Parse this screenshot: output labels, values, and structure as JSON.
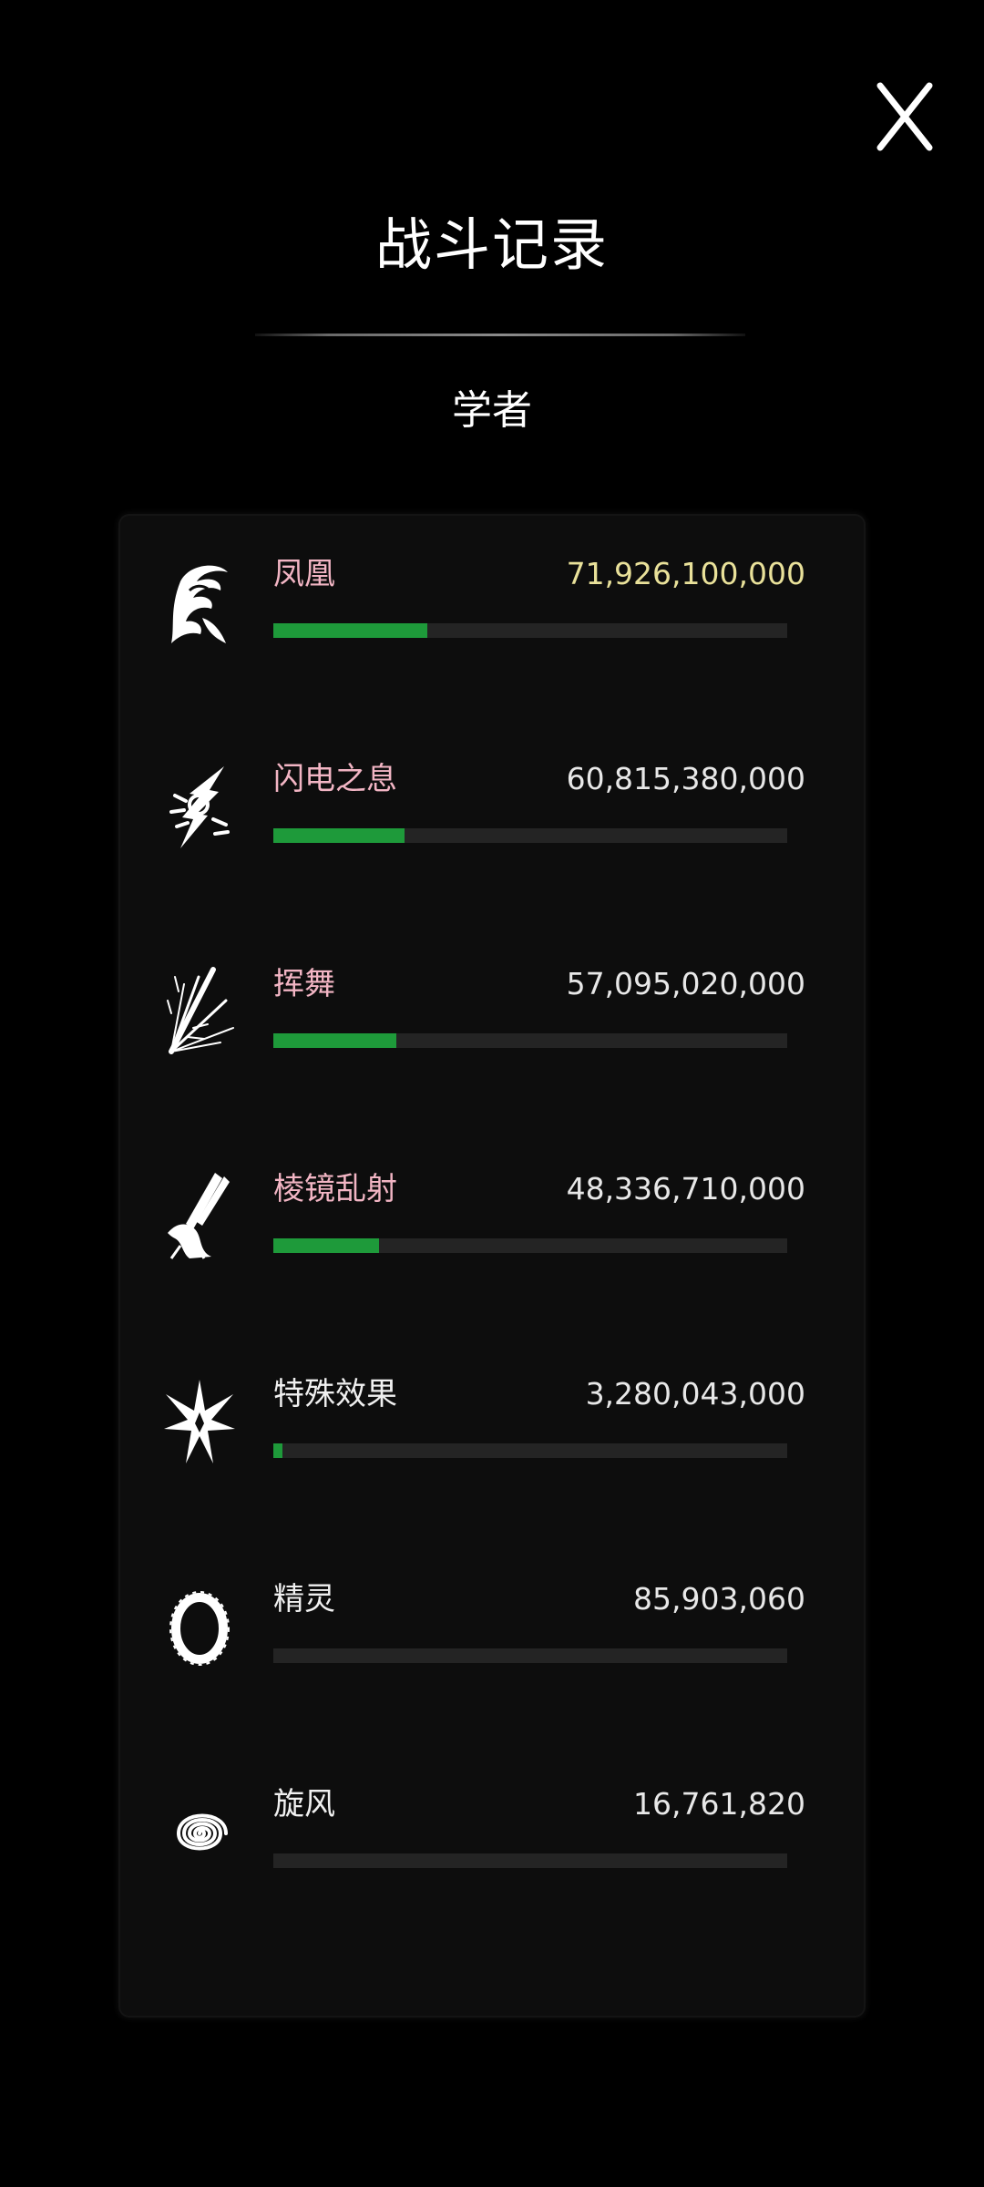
{
  "header": {
    "title": "战斗记录",
    "subtitle": "学者"
  },
  "colors": {
    "bar_fill": "#1e9a3a",
    "bar_track": "#242424",
    "skill_name_pink": "#f2b5c4",
    "top_value_gold": "#e9e19a"
  },
  "records": [
    {
      "icon": "phoenix-icon",
      "name": "凤凰",
      "value": "71,926,100,000",
      "progress": 0.3
    },
    {
      "icon": "lightning-icon",
      "name": "闪电之息",
      "value": "60,815,380,000",
      "progress": 0.255
    },
    {
      "icon": "slash-burst-icon",
      "name": "挥舞",
      "value": "57,095,020,000",
      "progress": 0.24
    },
    {
      "icon": "prism-beam-icon",
      "name": "棱镜乱射",
      "value": "48,336,710,000",
      "progress": 0.205
    },
    {
      "icon": "star-burst-icon",
      "name": "特殊效果",
      "value": "3,280,043,000",
      "progress": 0.017
    },
    {
      "icon": "ring-icon",
      "name": "精灵",
      "value": "85,903,060",
      "progress": 0.0
    },
    {
      "icon": "spiral-icon",
      "name": "旋风",
      "value": "16,761,820",
      "progress": 0.0
    }
  ]
}
